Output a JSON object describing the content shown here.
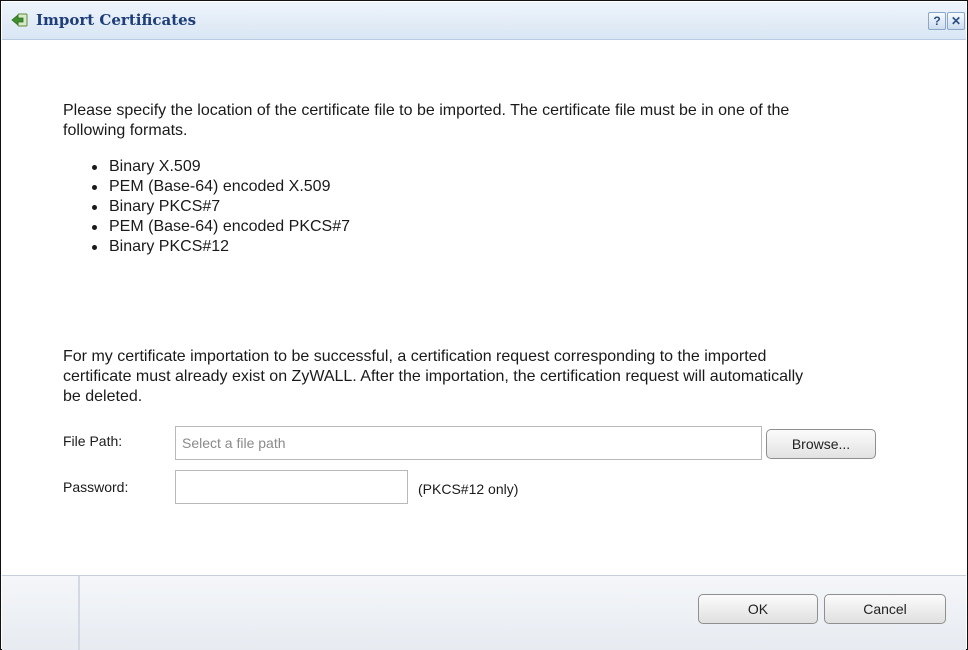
{
  "dialog": {
    "title": "Import Certificates",
    "help_label": "?",
    "close_label": "✕"
  },
  "intro_text": "Please specify the location of the certificate file to be imported. The certificate file must be in one of the following formats.",
  "formats": [
    "Binary X.509",
    "PEM (Base-64) encoded X.509",
    "Binary PKCS#7",
    "PEM (Base-64) encoded PKCS#7",
    "Binary PKCS#12"
  ],
  "note_text": "For my certificate importation to be successful, a certification request corresponding to the imported certificate must already exist on ZyWALL. After the importation, the certification request will automatically be deleted.",
  "form": {
    "file_path_label": "File Path:",
    "file_path_value": "",
    "file_path_placeholder": "Select a file path",
    "browse_label": "Browse...",
    "password_label": "Password:",
    "password_value": "",
    "password_hint": "(PKCS#12 only)"
  },
  "footer": {
    "ok_label": "OK",
    "cancel_label": "Cancel"
  }
}
